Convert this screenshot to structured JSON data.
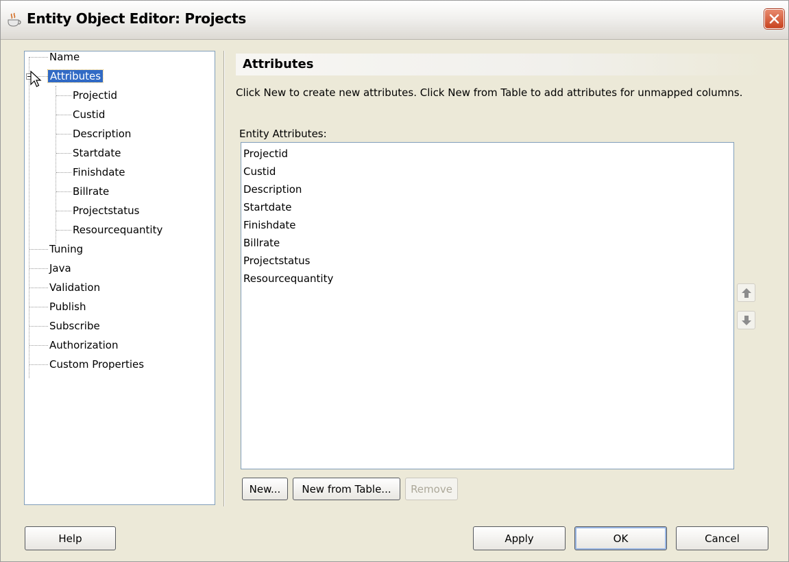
{
  "window": {
    "title": "Entity Object Editor: Projects",
    "icon": "java-cup-icon",
    "close_icon": "close-icon"
  },
  "nav": {
    "items": [
      {
        "label": "Name"
      },
      {
        "label": "Attributes",
        "selected": true,
        "expanded": true
      },
      {
        "label": "Tuning"
      },
      {
        "label": "Java"
      },
      {
        "label": "Validation"
      },
      {
        "label": "Publish"
      },
      {
        "label": "Subscribe"
      },
      {
        "label": "Authorization"
      },
      {
        "label": "Custom Properties"
      }
    ],
    "attribute_children": [
      "Projectid",
      "Custid",
      "Description",
      "Startdate",
      "Finishdate",
      "Billrate",
      "Projectstatus",
      "Resourcequantity"
    ]
  },
  "panel": {
    "title": "Attributes",
    "description": "Click New to create new attributes.  Click New from Table to add attributes for unmapped columns.",
    "list_label": "Entity Attributes:",
    "attributes": [
      "Projectid",
      "Custid",
      "Description",
      "Startdate",
      "Finishdate",
      "Billrate",
      "Projectstatus",
      "Resourcequantity"
    ],
    "buttons": {
      "new": "New...",
      "new_from_table": "New from Table...",
      "remove": "Remove"
    },
    "move_up_icon": "arrow-up-icon",
    "move_down_icon": "arrow-down-icon"
  },
  "footer": {
    "help": "Help",
    "apply": "Apply",
    "ok": "OK",
    "cancel": "Cancel"
  },
  "colors": {
    "selection": "#316ac5",
    "dialog_bg": "#ece9d8",
    "close_button": "#c8431f"
  }
}
